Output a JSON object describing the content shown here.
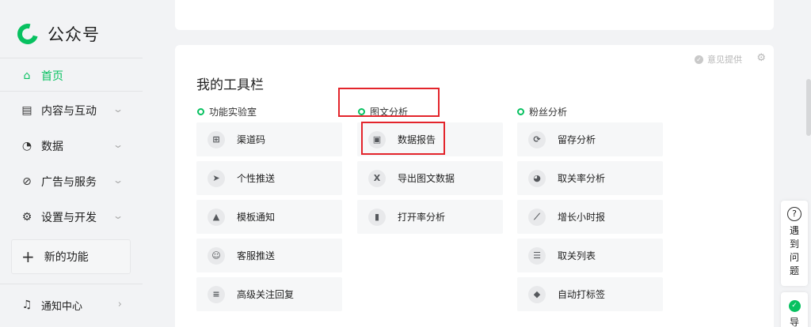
{
  "app": {
    "name": "公众号"
  },
  "sidebar": {
    "home": "首页",
    "items": [
      {
        "label": "内容与互动",
        "icon": "document-icon"
      },
      {
        "label": "数据",
        "icon": "pie-chart-icon"
      },
      {
        "label": "广告与服务",
        "icon": "compass-icon"
      },
      {
        "label": "设置与开发",
        "icon": "gear-icon"
      }
    ],
    "new_feature": "新的功能",
    "notify": "通知中心"
  },
  "toolbar": {
    "feedback": "意见提供",
    "title": "我的工具栏",
    "columns": [
      {
        "heading": "功能实验室",
        "tools": [
          {
            "label": "渠道码",
            "icon": "qrcode-icon"
          },
          {
            "label": "个性推送",
            "icon": "send-icon"
          },
          {
            "label": "模板通知",
            "icon": "bell-icon"
          },
          {
            "label": "客服推送",
            "icon": "customer-service-icon"
          },
          {
            "label": "高级关注回复",
            "icon": "chat-icon"
          }
        ]
      },
      {
        "heading": "图文分析",
        "tools": [
          {
            "label": "数据报告",
            "icon": "presentation-icon"
          },
          {
            "label": "导出图文数据",
            "icon": "excel-icon"
          },
          {
            "label": "打开率分析",
            "icon": "bar-chart-icon"
          }
        ]
      },
      {
        "heading": "粉丝分析",
        "tools": [
          {
            "label": "留存分析",
            "icon": "cycle-icon"
          },
          {
            "label": "取关率分析",
            "icon": "pie-icon"
          },
          {
            "label": "增长小时报",
            "icon": "trend-icon"
          },
          {
            "label": "取关列表",
            "icon": "list-icon"
          },
          {
            "label": "自动打标签",
            "icon": "tag-icon"
          }
        ]
      }
    ]
  },
  "float": {
    "help": "遇到问题",
    "guide": "导"
  },
  "colors": {
    "accent": "#07c160",
    "highlight": "#e3242b"
  }
}
